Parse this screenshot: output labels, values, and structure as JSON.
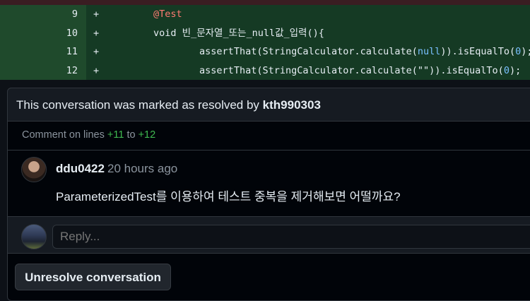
{
  "diff": {
    "lines": [
      {
        "num": "9",
        "sign": "+",
        "indent": "        ",
        "parts": [
          {
            "t": "@Test",
            "c": "annot"
          }
        ]
      },
      {
        "num": "10",
        "sign": "+",
        "indent": "        ",
        "parts": [
          {
            "t": "void 빈_문자열_또는_null값_입력(){",
            "c": "kw"
          }
        ]
      },
      {
        "num": "11",
        "sign": "+",
        "indent": "                ",
        "parts": [
          {
            "t": "assertThat(StringCalculator.calculate(",
            "c": "kw"
          },
          {
            "t": "null",
            "c": "num"
          },
          {
            "t": ")).isEqualTo(",
            "c": "kw"
          },
          {
            "t": "0",
            "c": "num"
          },
          {
            "t": ");",
            "c": "kw"
          }
        ]
      },
      {
        "num": "12",
        "sign": "+",
        "indent": "                ",
        "parts": [
          {
            "t": "assertThat(StringCalculator.calculate(\"\")).isEqualTo(",
            "c": "kw"
          },
          {
            "t": "0",
            "c": "num"
          },
          {
            "t": ");",
            "c": "kw"
          }
        ]
      }
    ]
  },
  "conversation": {
    "resolved_prefix": "This conversation was marked as resolved by",
    "resolved_by": "kth990303",
    "lines_prefix": "Comment on lines",
    "line_start": "+11",
    "lines_to": "to",
    "line_end": "+12",
    "comment": {
      "author": "ddu0422",
      "time": "20 hours ago",
      "body": "ParameterizedTest를 이용하여 테스트 중복을 제거해보면 어떨까요?"
    },
    "reply_placeholder": "Reply...",
    "unresolve_label": "Unresolve conversation"
  }
}
